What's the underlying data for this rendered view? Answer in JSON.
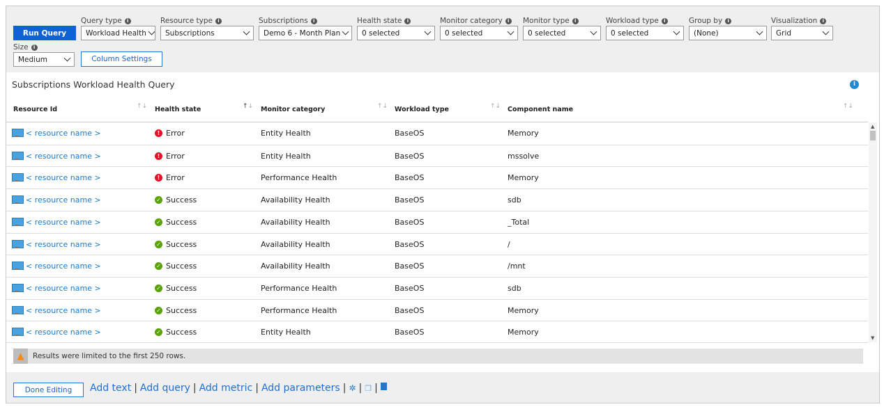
{
  "toolbar": {
    "run_query": "Run Query",
    "column_settings": "Column Settings",
    "filters": [
      {
        "label": "Query type",
        "value": "Workload Health"
      },
      {
        "label": "Resource type",
        "value": "Subscriptions"
      },
      {
        "label": "Subscriptions",
        "value": "Demo 6 - Month Plan"
      },
      {
        "label": "Health state",
        "value": "0 selected"
      },
      {
        "label": "Monitor category",
        "value": "0 selected"
      },
      {
        "label": "Monitor type",
        "value": "0 selected"
      },
      {
        "label": "Workload type",
        "value": "0 selected"
      },
      {
        "label": "Group by",
        "value": "(None)"
      },
      {
        "label": "Visualization",
        "value": "Grid"
      },
      {
        "label": "Size",
        "value": "Medium"
      }
    ]
  },
  "panel": {
    "title": "Subscriptions Workload Health Query"
  },
  "table": {
    "columns": [
      "Resource Id",
      "Health state",
      "Monitor category",
      "Workload type",
      "Component name"
    ],
    "rows": [
      {
        "resource": "< resource name >",
        "state": "Error",
        "category": "Entity Health",
        "workload": "BaseOS",
        "component": "Memory"
      },
      {
        "resource": "< resource name >",
        "state": "Error",
        "category": "Entity Health",
        "workload": "BaseOS",
        "component": "mssolve"
      },
      {
        "resource": "< resource name >",
        "state": "Error",
        "category": "Performance Health",
        "workload": "BaseOS",
        "component": "Memory"
      },
      {
        "resource": "< resource name >",
        "state": "Success",
        "category": "Availability Health",
        "workload": "BaseOS",
        "component": "sdb"
      },
      {
        "resource": "< resource name >",
        "state": "Success",
        "category": "Availability Health",
        "workload": "BaseOS",
        "component": "_Total"
      },
      {
        "resource": "< resource name >",
        "state": "Success",
        "category": "Availability Health",
        "workload": "BaseOS",
        "component": "/"
      },
      {
        "resource": "< resource name >",
        "state": "Success",
        "category": "Availability Health",
        "workload": "BaseOS",
        "component": "/mnt"
      },
      {
        "resource": "< resource name >",
        "state": "Success",
        "category": "Performance Health",
        "workload": "BaseOS",
        "component": "sdb"
      },
      {
        "resource": "< resource name >",
        "state": "Success",
        "category": "Performance Health",
        "workload": "BaseOS",
        "component": "Memory"
      },
      {
        "resource": "< resource name >",
        "state": "Success",
        "category": "Entity Health",
        "workload": "BaseOS",
        "component": "Memory"
      }
    ]
  },
  "warning": "Results were limited to the first 250 rows.",
  "footer": {
    "done": "Done Editing",
    "links": [
      "Add text",
      "Add query",
      "Add metric",
      "Add parameters"
    ],
    "sep": "|"
  },
  "colors": {
    "error": "#e81123",
    "success": "#57a300",
    "accent": "#0f62d6"
  }
}
